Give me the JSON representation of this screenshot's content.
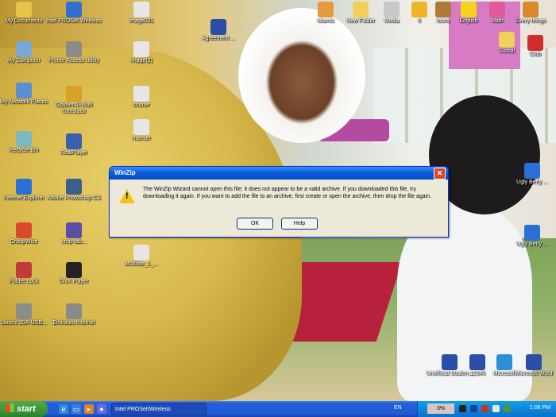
{
  "desktop": {
    "icons_left": [
      {
        "label": "My Documents",
        "icon": "folder-documents-icon",
        "color": "#e8c34a"
      },
      {
        "label": "My Computer",
        "icon": "computer-icon",
        "color": "#7aa7d8"
      },
      {
        "label": "My Network Places",
        "icon": "network-icon",
        "color": "#5b8fd3"
      },
      {
        "label": "Recycle Bin",
        "icon": "recycle-bin-icon",
        "color": "#7fb8c4"
      },
      {
        "label": "Internet Explorer",
        "icon": "internet-explorer-icon",
        "color": "#2a6fd4"
      },
      {
        "label": "GroupWise",
        "icon": "groupwise-icon",
        "color": "#d94a2a"
      },
      {
        "label": "Folder Lock",
        "icon": "folder-lock-icon",
        "color": "#c23a3a"
      },
      {
        "label": "Lucent 20A-USB...",
        "icon": "usb-icon",
        "color": "#8c8c8c"
      }
    ],
    "icons_col2": [
      {
        "label": "Intel PROSet Wireless",
        "icon": "wireless-icon",
        "color": "#2f6fcf"
      },
      {
        "label": "Printer Access Utility",
        "icon": "printer-icon",
        "color": "#8a8a8a"
      },
      {
        "label": "Golden Al-Wafi Translator",
        "icon": "translator-icon",
        "color": "#d9a12a"
      },
      {
        "label": "RealPlayer",
        "icon": "realplayer-icon",
        "color": "#3a5fae"
      },
      {
        "label": "Adobe Photoshop CS",
        "icon": "photoshop-icon",
        "color": "#3a5f8e"
      },
      {
        "label": "crop-tab...",
        "icon": "crop-icon",
        "color": "#5b4ea8"
      },
      {
        "label": "DivX Player",
        "icon": "divx-icon",
        "color": "#222222"
      },
      {
        "label": "Emirates Internet",
        "icon": "emirates-internet-icon",
        "color": "#8a8a8a"
      }
    ],
    "icons_col3": [
      {
        "label": "image001",
        "icon": "image-file-icon",
        "color": "#e6e6e6"
      },
      {
        "label": "image(2)",
        "icon": "image-file-icon",
        "color": "#e6e6e6"
      },
      {
        "label": "shutter",
        "icon": "image-file-icon",
        "color": "#e6e6e6"
      },
      {
        "label": "manser",
        "icon": "image-file-icon",
        "color": "#e6e6e6"
      },
      {
        "label": "ac3filter_1_...",
        "icon": "installer-icon",
        "color": "#e6e6e6"
      }
    ],
    "icon_doc_top": {
      "label": "Agreement ...",
      "icon": "word-document-icon",
      "color": "#2b4fa8"
    },
    "icons_top_right": [
      {
        "label": "Islamic",
        "icon": "islamic-icon",
        "color": "#e79a3b"
      },
      {
        "label": "New Folder",
        "icon": "folder-icon",
        "color": "#f0cf5a"
      },
      {
        "label": "Media",
        "icon": "media-bunny-icon",
        "color": "#c8c8c8"
      },
      {
        "label": "6",
        "icon": "pencil-icon",
        "color": "#f0b428"
      },
      {
        "label": "Icons",
        "icon": "bear-icon",
        "color": "#b07a3a"
      },
      {
        "label": "English",
        "icon": "smiley-icon",
        "color": "#f5d21f"
      },
      {
        "label": "Math",
        "icon": "heart-icon",
        "color": "#e05a9a"
      },
      {
        "label": "Every things",
        "icon": "burger-icon",
        "color": "#d98a2a"
      },
      {
        "label": "Global",
        "icon": "folder-icon",
        "color": "#f0cf5a"
      },
      {
        "label": "Club",
        "icon": "car-icon",
        "color": "#d42a2a"
      }
    ],
    "icons_right": [
      {
        "label": "Ugly Betty ...",
        "icon": "media-file-icon",
        "color": "#2a6fd4"
      },
      {
        "label": "Ugly Betty ...",
        "icon": "media-file-icon",
        "color": "#2a6fd4"
      }
    ],
    "icons_bottom_right": [
      {
        "label": "Unofficial Studen...",
        "icon": "word-document-icon",
        "color": "#2b4fa8"
      },
      {
        "label": "12345",
        "icon": "word-document-icon",
        "color": "#2b4fa8"
      },
      {
        "label": "Microsoft",
        "icon": "globe-icon",
        "color": "#2a8fd4"
      },
      {
        "label": "Microsoft Word",
        "icon": "word-icon",
        "color": "#2b4fa8"
      }
    ]
  },
  "dialog": {
    "title": "WinZip",
    "message": "The WinZip Wizard cannot open this file; it does not appear to be a valid archive.  If you downloaded this file, try downloading it again.  If you want to add the file to an archive, first create or open the archive, then drop the file again.",
    "ok_label": "OK",
    "help_label": "Help",
    "close_glyph": "✕"
  },
  "taskbar": {
    "start_label": "start",
    "task_button_label": "Intel PROSet/Wireless",
    "language": "EN",
    "battery_percent": "3%",
    "clock": "1:06 PM"
  }
}
